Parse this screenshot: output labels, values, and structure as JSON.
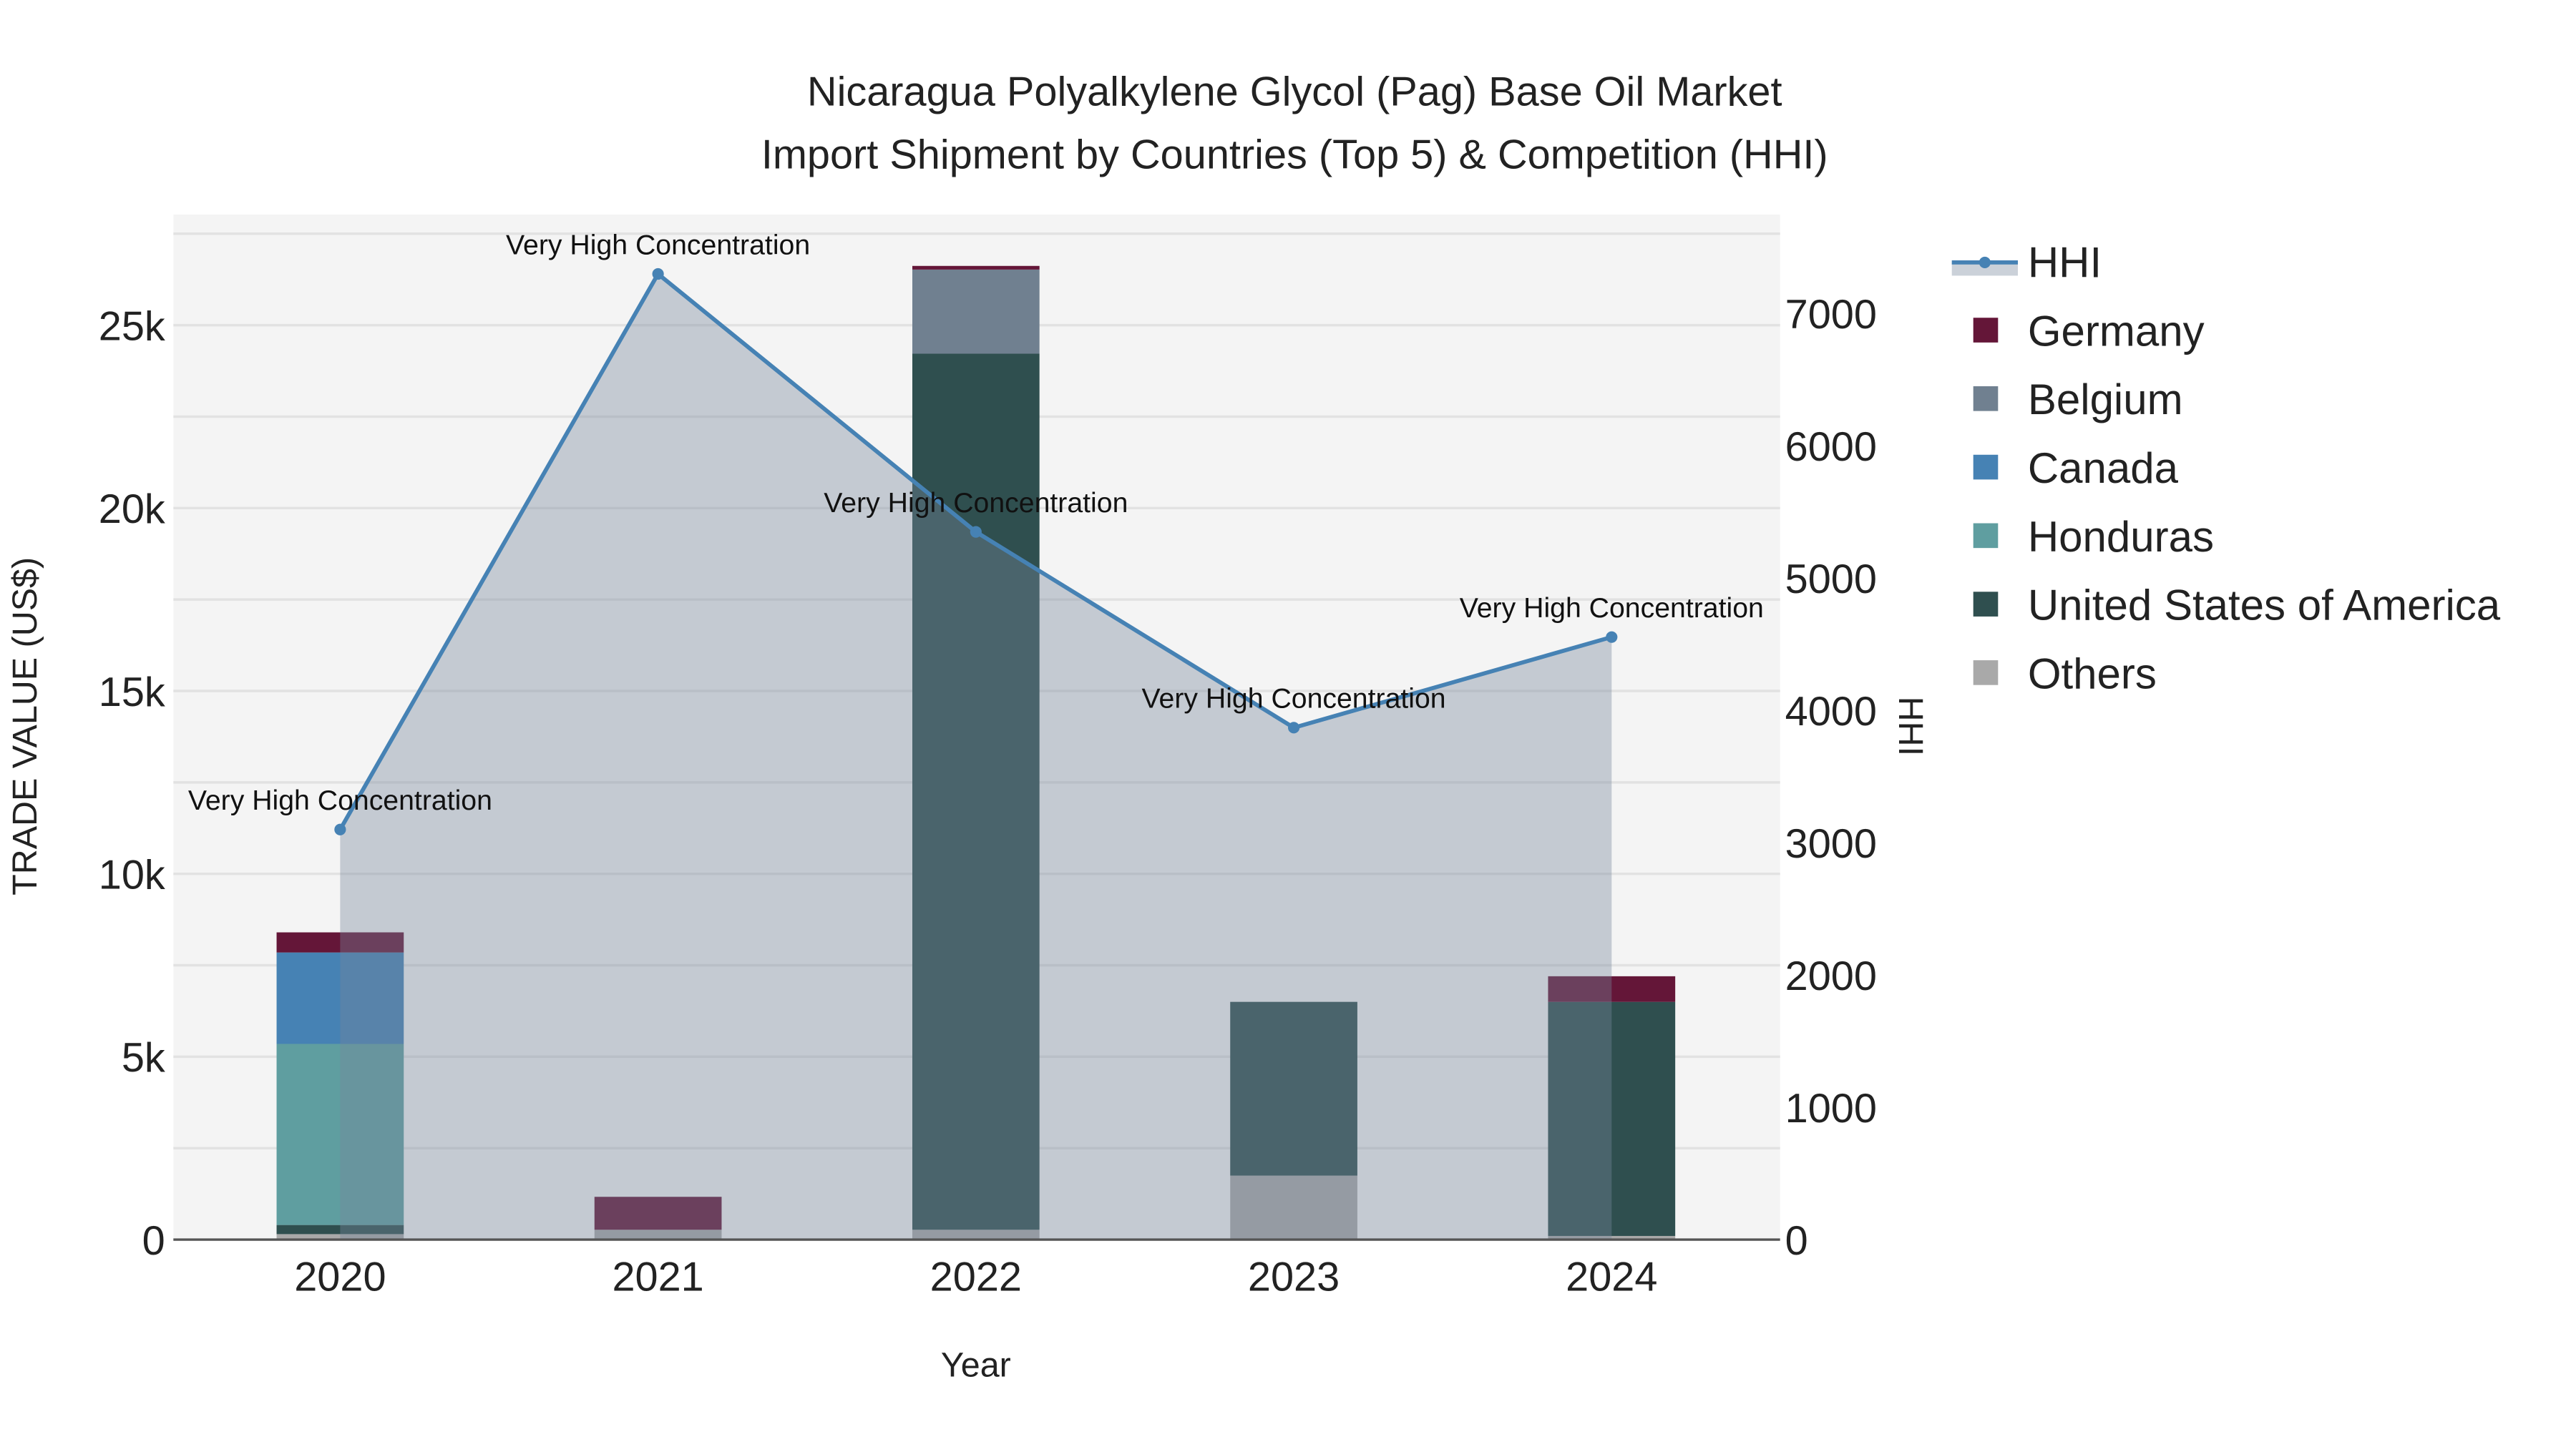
{
  "chart_data": {
    "type": "bar",
    "title_line1": "Nicaragua Polyalkylene Glycol (Pag) Base Oil Market",
    "title_line2": "Import Shipment by Countries (Top 5) & Competition (HHI)",
    "xlabel": "Year",
    "ylabel": "TRADE VALUE (US$)",
    "y2label": "HHI",
    "categories": [
      "2020",
      "2021",
      "2022",
      "2023",
      "2024"
    ],
    "ylim": [
      0,
      28000
    ],
    "y_ticks": [
      0,
      5000,
      10000,
      15000,
      20000,
      25000
    ],
    "y_tick_labels": [
      "0",
      "5k",
      "10k",
      "15k",
      "20k",
      "25k"
    ],
    "y2lim": [
      0,
      7750
    ],
    "y2_ticks": [
      0,
      1000,
      2000,
      3000,
      4000,
      5000,
      6000,
      7000
    ],
    "y2_tick_labels": [
      "0",
      "1000",
      "2000",
      "3000",
      "4000",
      "5000",
      "6000",
      "7000"
    ],
    "series": [
      {
        "name": "Others",
        "color": "#a9a9a9",
        "values": [
          150,
          270,
          270,
          1750,
          100
        ]
      },
      {
        "name": "United States of America",
        "color": "#2f4f4f",
        "values": [
          250,
          0,
          23950,
          4750,
          6400
        ]
      },
      {
        "name": "Honduras",
        "color": "#5f9ea0",
        "values": [
          4950,
          0,
          0,
          0,
          0
        ]
      },
      {
        "name": "Canada",
        "color": "#4682b4",
        "values": [
          2500,
          0,
          0,
          0,
          0
        ]
      },
      {
        "name": "Belgium",
        "color": "#708090",
        "values": [
          0,
          0,
          2300,
          0,
          0
        ]
      },
      {
        "name": "Germany",
        "color": "#641638",
        "values": [
          550,
          900,
          100,
          0,
          700
        ]
      }
    ],
    "hhi": {
      "name": "HHI",
      "color": "#4682b4",
      "values": [
        3100,
        7300,
        5350,
        3870,
        4555
      ],
      "annotations": [
        "Very High Concentration",
        "Very High Concentration",
        "Very High Concentration",
        "Very High Concentration",
        "Very High Concentration"
      ]
    },
    "legend_order": [
      "HHI",
      "Germany",
      "Belgium",
      "Canada",
      "Honduras",
      "United States of America",
      "Others"
    ],
    "legend_placement": "right",
    "grid": true
  }
}
